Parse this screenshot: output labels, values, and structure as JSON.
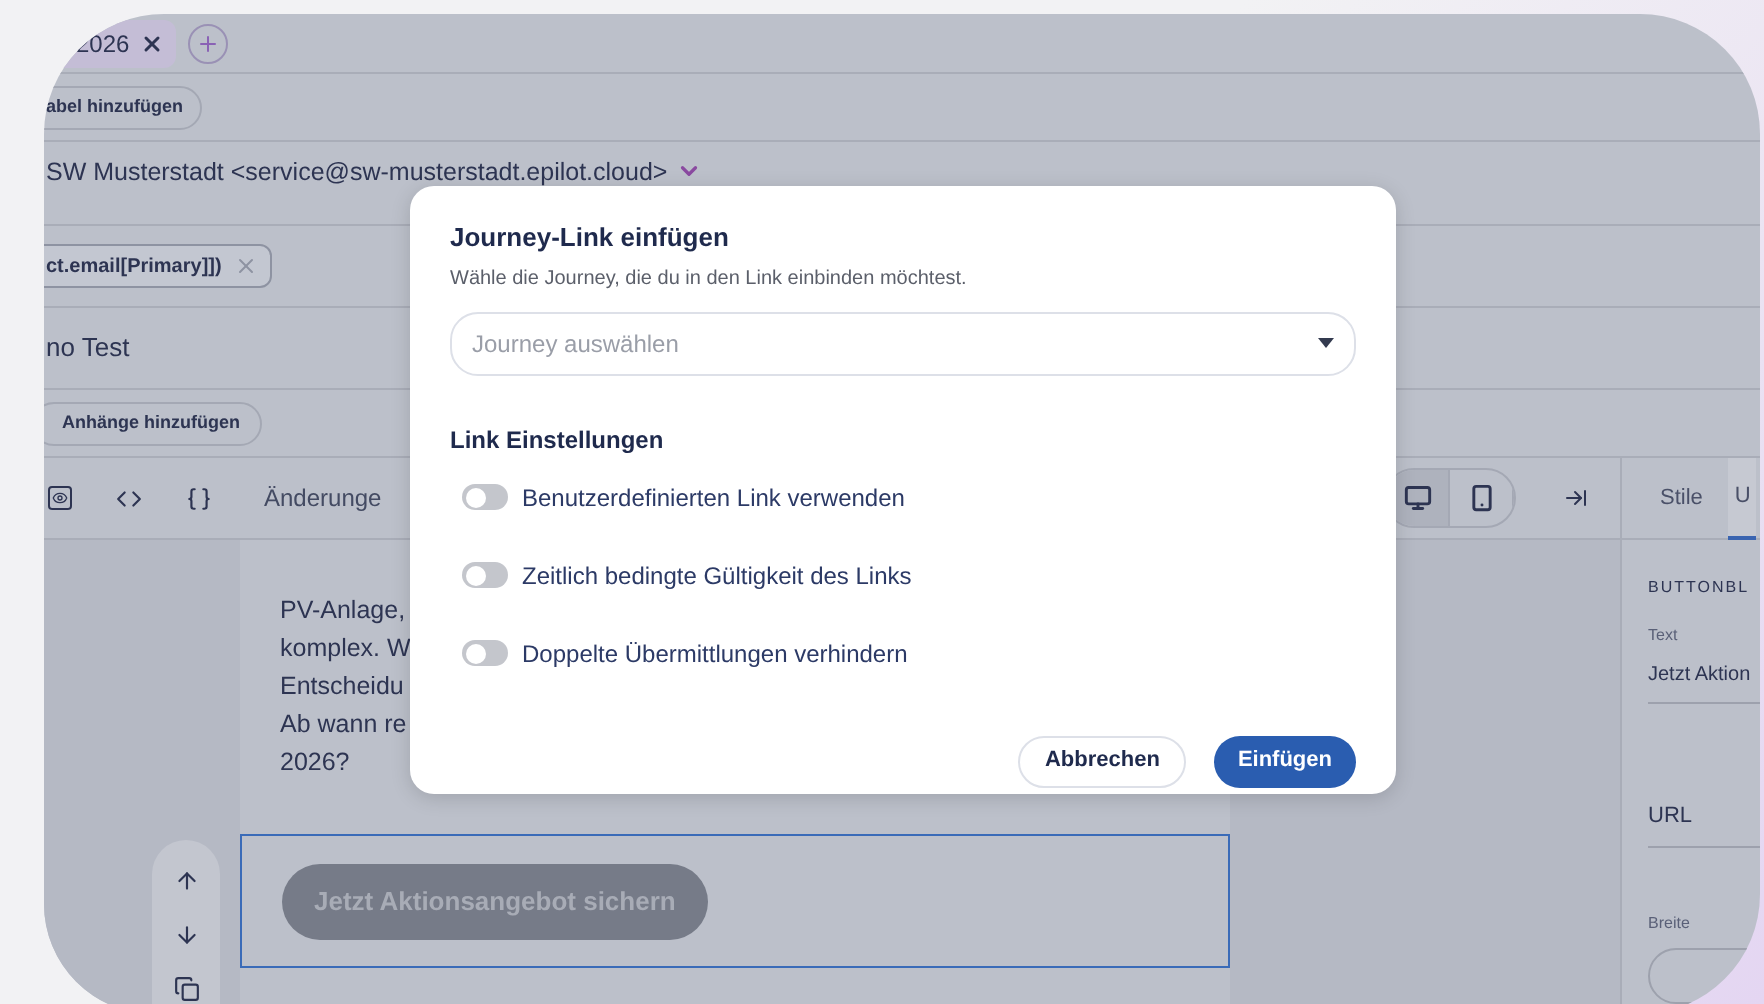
{
  "header": {
    "tag": "2026",
    "labels_button": "abel hinzufügen",
    "sender": "SW Musterstadt <service@sw-musterstadt.epilot.cloud>",
    "recipient_chip": "ct.email[Primary]])",
    "subject": "no Test",
    "attachments_button": "Anhänge hinzufügen"
  },
  "toolbar": {
    "changes": "Änderunge",
    "devices": [
      {
        "kind": "desktop",
        "selected": true
      },
      {
        "kind": "mobile",
        "selected": false
      }
    ]
  },
  "panel_tabs": [
    {
      "label": "Stile",
      "selected": false
    },
    {
      "label": "U",
      "selected": true
    }
  ],
  "panel": {
    "section": "BUTTONBL",
    "text_label": "Text",
    "text_value": "Jetzt Aktion",
    "url_label": "URL",
    "width_label": "Breite"
  },
  "canvas": {
    "lines": [
      "PV-Anlage,",
      "komplex. W",
      "Entscheidu",
      "Ab wann re",
      "2026?"
    ],
    "button": "Jetzt Aktionsangebot sichern"
  },
  "dialog": {
    "title": "Journey-Link einfügen",
    "subtitle": "Wähle die Journey, die du in den Link einbinden möchtest.",
    "select_placeholder": "Journey auswählen",
    "section": "Link Einstellungen",
    "toggles": [
      {
        "label": "Benutzerdefinierten Link verwenden",
        "on": false
      },
      {
        "label": "Zeitlich bedingte Gültigkeit des Links",
        "on": false
      },
      {
        "label": "Doppelte Übermittlungen verhindern",
        "on": false
      }
    ],
    "buttons": [
      {
        "label": "Abbrechen",
        "kind": "secondary"
      },
      {
        "label": "Einfügen",
        "kind": "primary"
      }
    ]
  }
}
